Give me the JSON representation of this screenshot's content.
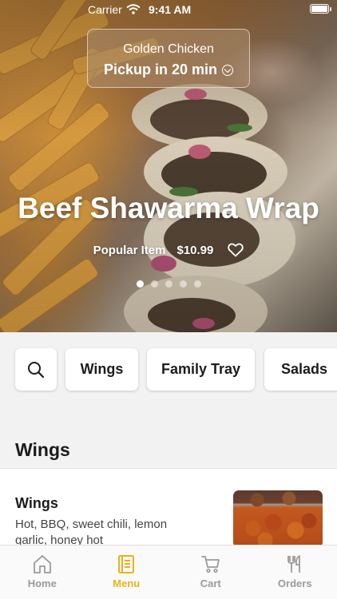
{
  "status_bar": {
    "carrier": "Carrier",
    "time": "9:41 AM"
  },
  "location": {
    "name": "Golden Chicken",
    "pickup": "Pickup in 20 min"
  },
  "hero": {
    "title": "Beef Shawarma Wrap",
    "tag": "Popular Item",
    "price": "$10.99",
    "page_count": 5,
    "active_page": 1
  },
  "categories": [
    "Wings",
    "Family Tray",
    "Salads"
  ],
  "section": {
    "title": "Wings"
  },
  "menu_item": {
    "name": "Wings",
    "description": "Hot, BBQ, sweet chili, lemon garlic, honey hot"
  },
  "tabs": {
    "home": "Home",
    "menu": "Menu",
    "cart": "Cart",
    "orders": "Orders",
    "active": "Menu"
  },
  "colors": {
    "accent": "#e8b21c",
    "inactive": "#9a9a9a"
  }
}
